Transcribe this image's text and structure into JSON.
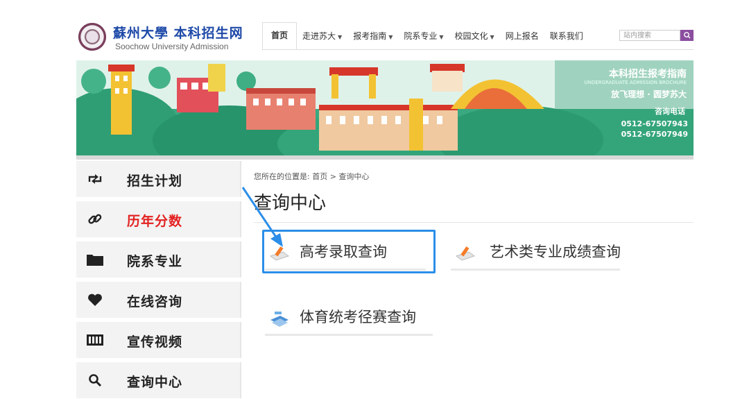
{
  "header": {
    "logo_cn": "蘇州大學 本科招生网",
    "logo_en": "Soochow University Admission",
    "nav": [
      {
        "label": "首页",
        "active": true,
        "caret": false
      },
      {
        "label": "走进苏大",
        "active": false,
        "caret": true
      },
      {
        "label": "报考指南",
        "active": false,
        "caret": true
      },
      {
        "label": "院系专业",
        "active": false,
        "caret": true
      },
      {
        "label": "校园文化",
        "active": false,
        "caret": true
      },
      {
        "label": "网上报名",
        "active": false,
        "caret": false
      },
      {
        "label": "联系我们",
        "active": false,
        "caret": false
      }
    ],
    "search_placeholder": "站内搜索"
  },
  "banner": {
    "title": "本科招生报考指南",
    "subtitle_en": "UNDERGRADUATE ADMISSION BROCHURE",
    "slogan": "放飞理想 · 圆梦苏大",
    "phone_label": "咨询电话",
    "phones": [
      "0512-67507943",
      "0512-67507949"
    ]
  },
  "sidebar": {
    "items": [
      {
        "label": "招生计划",
        "icon": "retweet-icon",
        "active": false
      },
      {
        "label": "历年分数",
        "icon": "link-icon",
        "active": true
      },
      {
        "label": "院系专业",
        "icon": "folder-icon",
        "active": false
      },
      {
        "label": "在线咨询",
        "icon": "heart-icon",
        "active": false
      },
      {
        "label": "宣传视频",
        "icon": "film-icon",
        "active": false
      },
      {
        "label": "查询中心",
        "icon": "search-icon",
        "active": false
      }
    ]
  },
  "main": {
    "breadcrumb": "您所在的位置是: 首页 > 查询中心",
    "title": "查询中心",
    "queries": [
      {
        "label": "高考录取查询",
        "icon": "pencil-paper-icon"
      },
      {
        "label": "艺术类专业成绩查询",
        "icon": "pencil-paper-icon"
      },
      {
        "label": "体育统考径赛查询",
        "icon": "book-stack-icon"
      }
    ]
  },
  "colors": {
    "accent_red": "#e32121",
    "highlight_blue": "#2b8ee8",
    "banner_green": "#2fa67c",
    "search_purple": "#8b4ea0"
  }
}
